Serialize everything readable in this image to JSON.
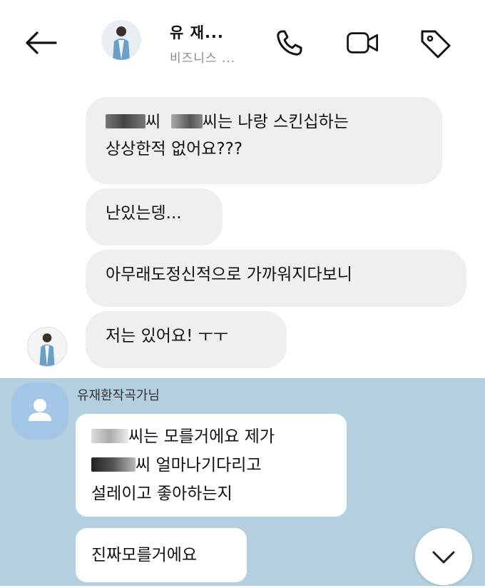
{
  "header": {
    "name": "유 재...",
    "subtitle": "비즈니스 ..."
  },
  "instagram_messages": [
    {
      "line1_after": "씨",
      "line1_tail": "씨는 나랑 스킨십하는",
      "line2": "상상한적 없어요???"
    },
    {
      "text": "난있는뎅..."
    },
    {
      "text": "아무래도정신적으로 가까워지다보니"
    },
    {
      "text": "저는 있어요! ㅜㅜ"
    }
  ],
  "kakao": {
    "sender": "유재환작곡가님",
    "message1": {
      "line1": "씨는 모를거에요 제가",
      "line2": "씨 얼마나기다리고",
      "line3": "설레이고 좋아하는지"
    },
    "message2": "진짜모를거에요"
  },
  "colors": {
    "kakao_bg": "#b3cfe0",
    "ig_bubble": "#efefef"
  },
  "icons": [
    "back-arrow-icon",
    "phone-icon",
    "video-icon",
    "tag-icon",
    "chevron-down-icon",
    "person-icon"
  ]
}
